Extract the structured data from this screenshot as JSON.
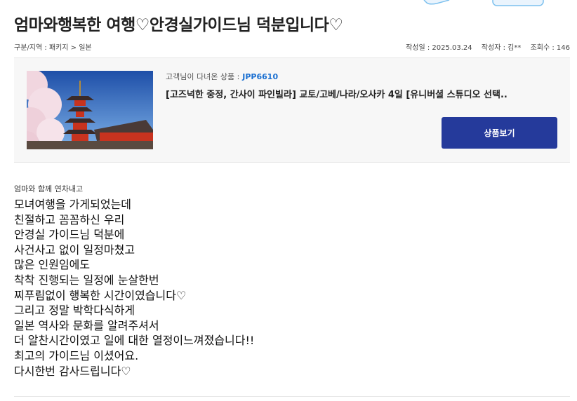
{
  "post": {
    "title": "엄마와행복한 여행♡안경실가이드님 덕분입니다♡",
    "category": "구분/지역 : 패키지 > 일본",
    "date": "작성일 : 2025.03.24",
    "author": "작성자 : 김**",
    "views": "조회수 : 146"
  },
  "product": {
    "label": "고객님이 다녀온 상품 :",
    "code": "JPP6610",
    "name": "[고즈넉한 중정, 간사이 파인빌라] 교토/고베/나라/오사카 4일 [유니버셜 스튜디오 선택..",
    "button_label": "상품보기",
    "accent_color": "#253a9b",
    "code_color": "#1a6fd1"
  },
  "review": {
    "intro": "엄마와 함께 연차내고",
    "lines": [
      "모녀여행을 가게되었는데",
      "친절하고 꼼꼼하신 우리",
      "안경실 가이드님 덕분에",
      "사건사고 없이 일정마쳤고",
      "많은 인원임에도",
      "착착 진행되는 일정에 눈살한번",
      "찌푸림없이 행복한 시간이였습니다♡",
      "그리고 정말 박학다식하게",
      "일본 역사와 문화를 알려주셔서",
      "더 알찬시간이였고 일에 대한 열정이느껴졌습니다!!",
      "최고의 가이드님 이셨어요.",
      "다시한번 감사드립니다♡"
    ]
  }
}
